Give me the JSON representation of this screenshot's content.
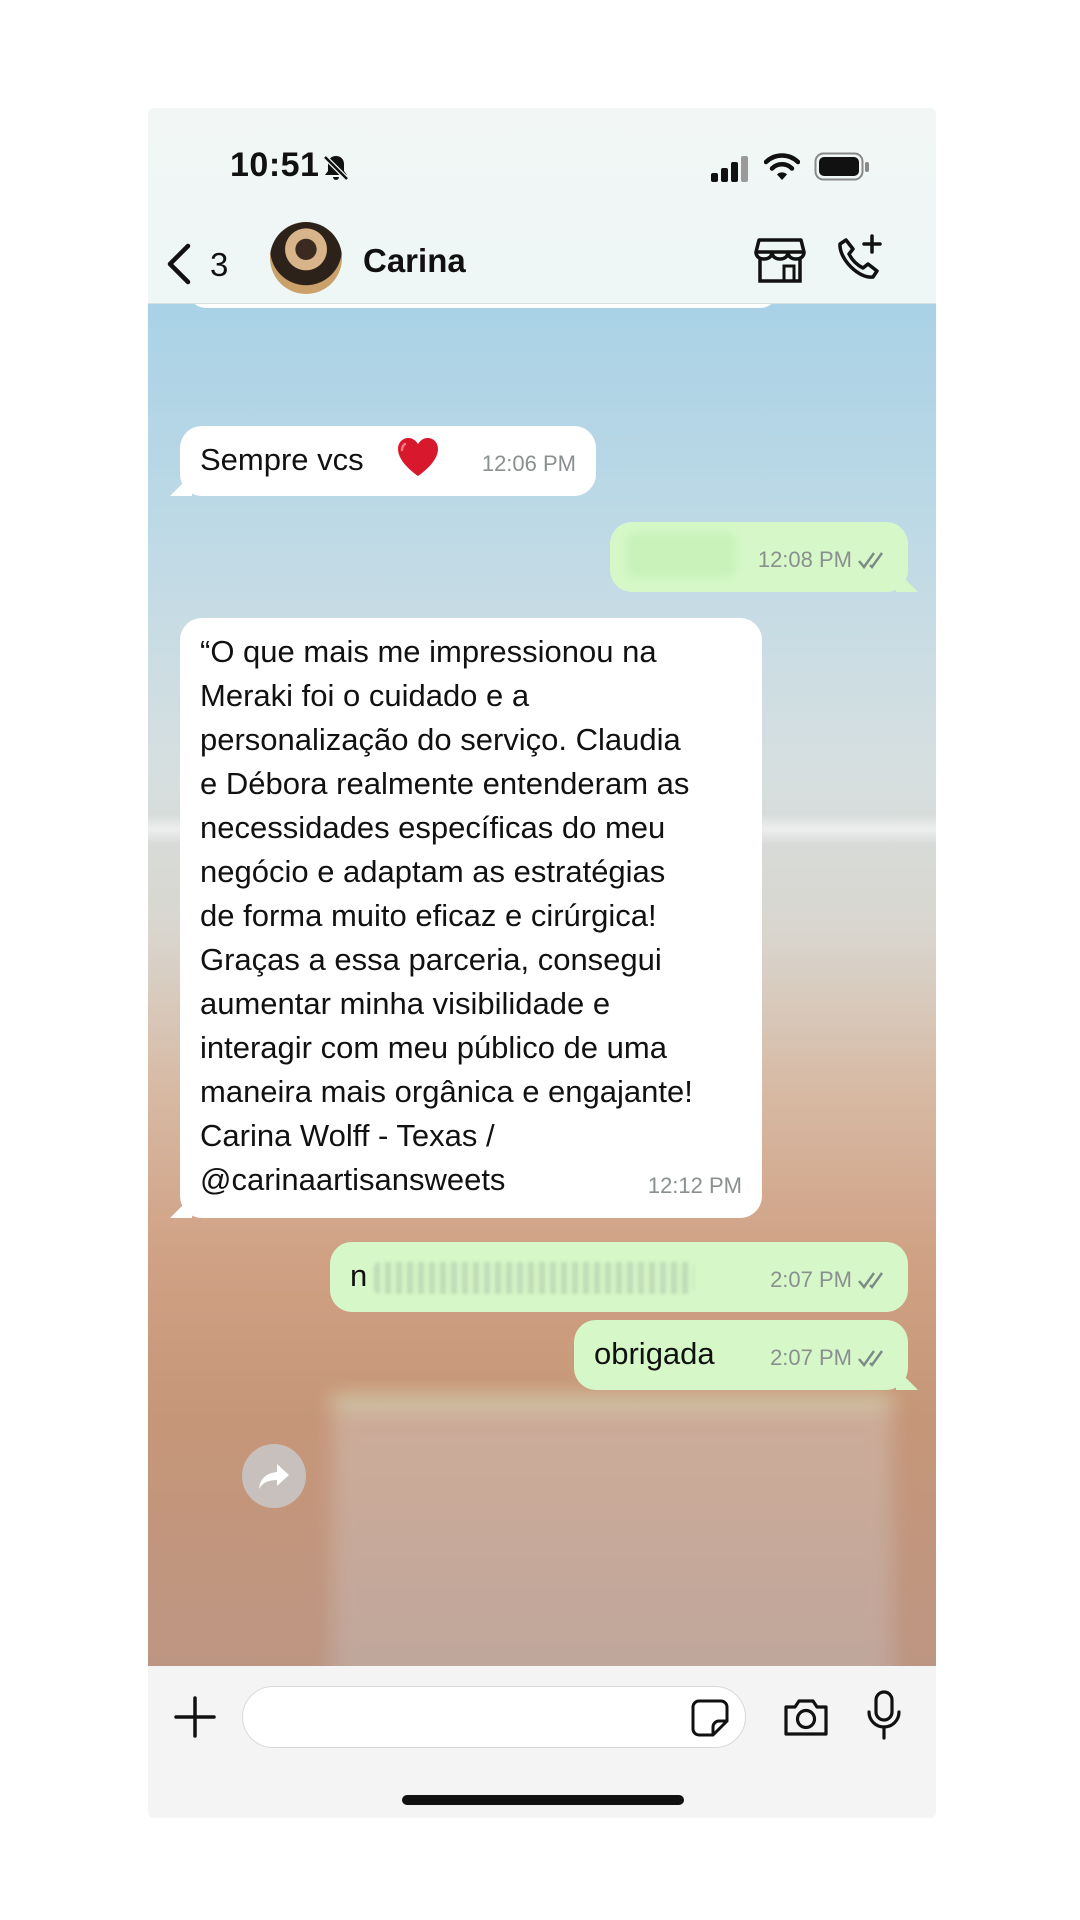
{
  "status_bar": {
    "time": "10:51",
    "icons": [
      "bell-muted-icon",
      "signal-icon",
      "wifi-icon",
      "battery-icon"
    ]
  },
  "header": {
    "back_count": "3",
    "contact_name": "Carina",
    "icons": [
      "back-chevron-icon",
      "store-icon",
      "call-add-icon"
    ]
  },
  "messages": [
    {
      "direction": "in",
      "text": "Sempre vcs",
      "emoji": "heart-icon",
      "time": "12:06 PM"
    },
    {
      "direction": "out",
      "text": "",
      "time": "12:08 PM",
      "read": true
    },
    {
      "direction": "in",
      "text": "“O que mais me impressionou na\nMeraki foi o cuidado e a\npersonalização do serviço. Claudia\ne Débora realmente entenderam as\nnecessidades específicas do meu\nnegócio e adaptam as estratégias\nde forma muito eficaz e cirúrgica!\nGraças a essa parceria, consegui\naumentar minha visibilidade e\ninteragir com meu público de uma\nmaneira mais orgânica e engajante!\nCarina Wolff - Texas /\n@carinaartisansweets",
      "time": "12:12 PM"
    },
    {
      "direction": "out",
      "text": "n",
      "time": "2:07 PM",
      "read": true
    },
    {
      "direction": "out",
      "text": "obrigada",
      "time": "2:07 PM",
      "read": true
    }
  ],
  "composer": {
    "placeholder": "",
    "icons": [
      "plus-icon",
      "sticker-icon",
      "camera-icon",
      "mic-icon"
    ]
  },
  "colors": {
    "outgoing_bubble": "#d6f8c8",
    "incoming_bubble": "#ffffff",
    "meta_text": "#8a8f90"
  }
}
